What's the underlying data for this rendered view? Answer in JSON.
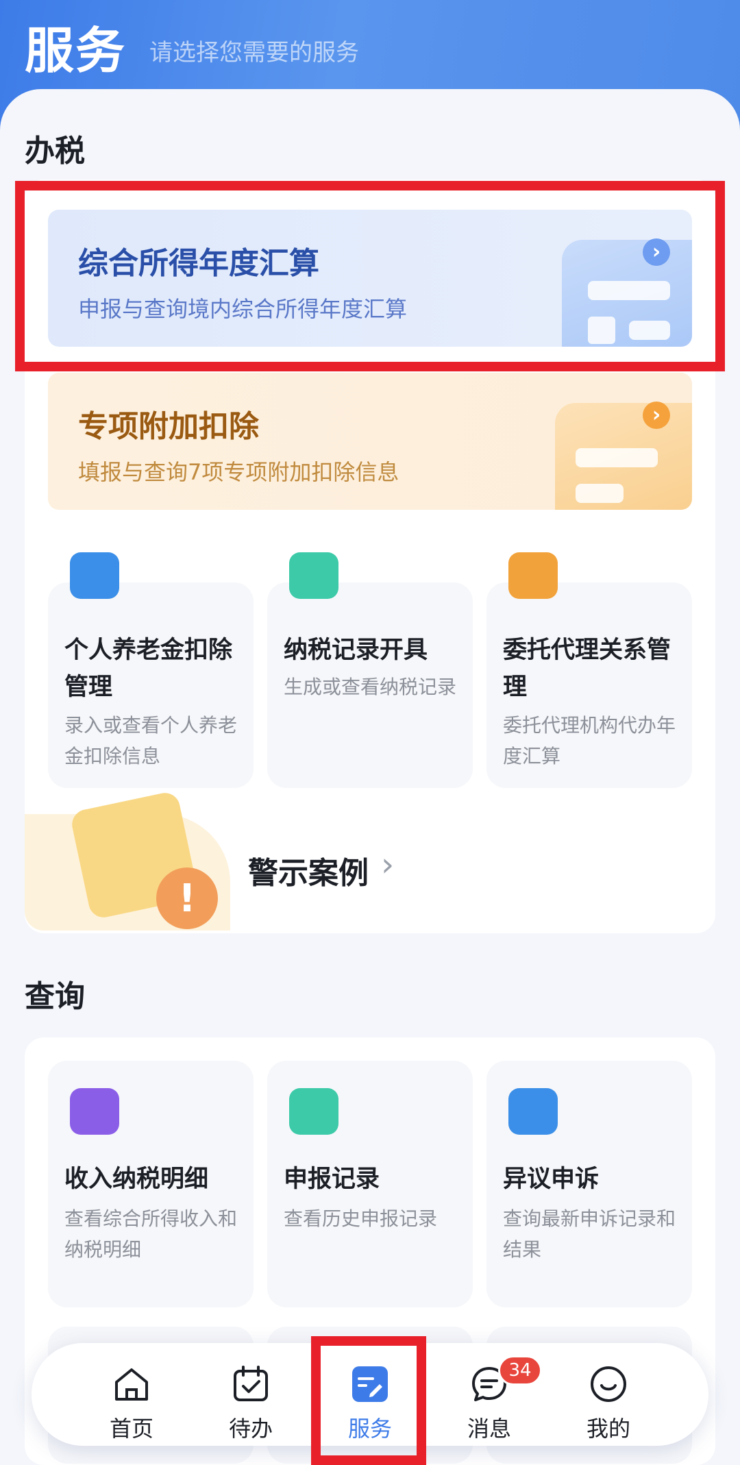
{
  "header": {
    "title": "服务",
    "subtitle": "请选择您需要的服务"
  },
  "tax_section": {
    "title": "办税",
    "annual_settlement": {
      "title": "综合所得年度汇算",
      "desc": "申报与查询境内综合所得年度汇算",
      "icon": "chevron-right-icon"
    },
    "special_deduction": {
      "title": "专项附加扣除",
      "desc": "填报与查询7项专项附加扣除信息",
      "icon": "chevron-right-icon"
    },
    "cards": [
      {
        "title": "个人养老金扣除管理",
        "desc": "录入或查看个人养老金扣除信息",
        "icon": "pension-card-icon",
        "color": "#3b8fe8"
      },
      {
        "title": "纳税记录开具",
        "desc": "生成或查看纳税记录",
        "icon": "tax-record-icon",
        "color": "#3ccaa8"
      },
      {
        "title": "委托代理关系管理",
        "desc": "委托代理机构代办年度汇算",
        "icon": "agency-icon",
        "color": "#f2a23a"
      }
    ],
    "warning": {
      "label": "警示案例",
      "icon": "warning-clipboard-icon"
    }
  },
  "query_section": {
    "title": "查询",
    "cards": [
      {
        "title": "收入纳税明细",
        "desc": "查看综合所得收入和纳税明细",
        "icon": "income-wallet-icon",
        "color": "#8b5ee8"
      },
      {
        "title": "申报记录",
        "desc": "查看历史申报记录",
        "icon": "declaration-search-icon",
        "color": "#3ccaa8"
      },
      {
        "title": "异议申诉",
        "desc": "查询最新申诉记录和结果",
        "icon": "appeal-folder-icon",
        "color": "#3b8fe8"
      }
    ]
  },
  "tabbar": {
    "items": [
      {
        "label": "首页",
        "icon": "home-icon"
      },
      {
        "label": "待办",
        "icon": "calendar-check-icon"
      },
      {
        "label": "服务",
        "icon": "service-icon",
        "active": true
      },
      {
        "label": "消息",
        "icon": "message-icon",
        "badge": "34"
      },
      {
        "label": "我的",
        "icon": "profile-icon"
      }
    ]
  },
  "colors": {
    "primary": "#3d7be8",
    "highlight": "#e8202a",
    "badge": "#e8453c"
  }
}
